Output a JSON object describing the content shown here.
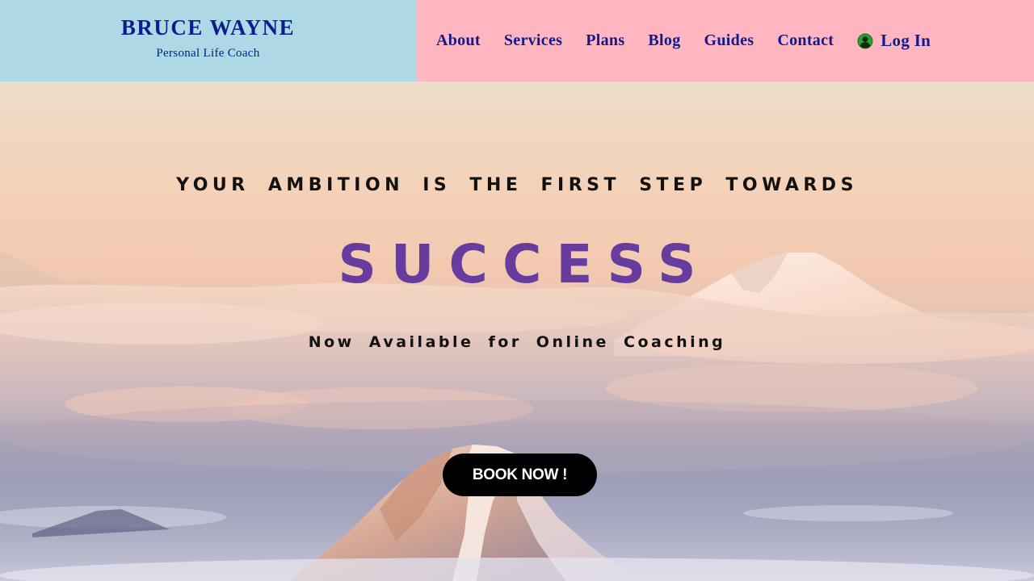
{
  "brand": {
    "name": "BRUCE WAYNE",
    "tagline": "Personal Life Coach"
  },
  "nav": {
    "items": [
      {
        "label": "About"
      },
      {
        "label": "Services"
      },
      {
        "label": "Plans"
      },
      {
        "label": "Blog"
      },
      {
        "label": "Guides"
      },
      {
        "label": "Contact"
      }
    ],
    "login": {
      "label": "Log In",
      "icon": "user-circle-icon"
    }
  },
  "hero": {
    "headline": "YOUR AMBITION IS THE FIRST STEP TOWARDS",
    "highlight": "SUCCESS",
    "subline": "Now Available for Online Coaching",
    "cta_label": "BOOK NOW !",
    "background": "mountain-peaks-above-clouds-at-sunrise"
  },
  "colors": {
    "brand_bg": "#add8e6",
    "nav_bg": "#ffb6c1",
    "nav_text": "#0f1a8c",
    "highlight": "#663d9e",
    "cta_bg": "#000000",
    "login_icon": "#2e9e2e"
  }
}
